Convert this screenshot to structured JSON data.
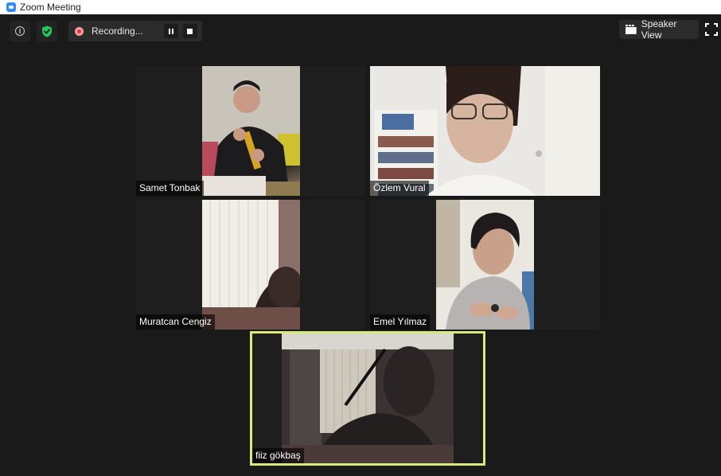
{
  "window": {
    "title": "Zoom Meeting"
  },
  "toolbar": {
    "info_icon": "info-icon",
    "shield_icon": "shield-check-icon",
    "recording_label": "Recording...",
    "pause_icon": "pause-icon",
    "stop_icon": "stop-icon",
    "speaker_view_label": "Speaker View",
    "fullscreen_icon": "fullscreen-icon"
  },
  "colors": {
    "active_speaker_border": "#d9e87a",
    "shield_green": "#22c55e",
    "recording_red": "#d93a47",
    "background": "#1a1a1a"
  },
  "participants": [
    {
      "name": "Samet Tonbak"
    },
    {
      "name": "Özlem Vural"
    },
    {
      "name": "Muratcan Cengiz"
    },
    {
      "name": "Emel Yılmaz"
    },
    {
      "name": "fiiz gökbaş",
      "active_speaker": true
    }
  ]
}
